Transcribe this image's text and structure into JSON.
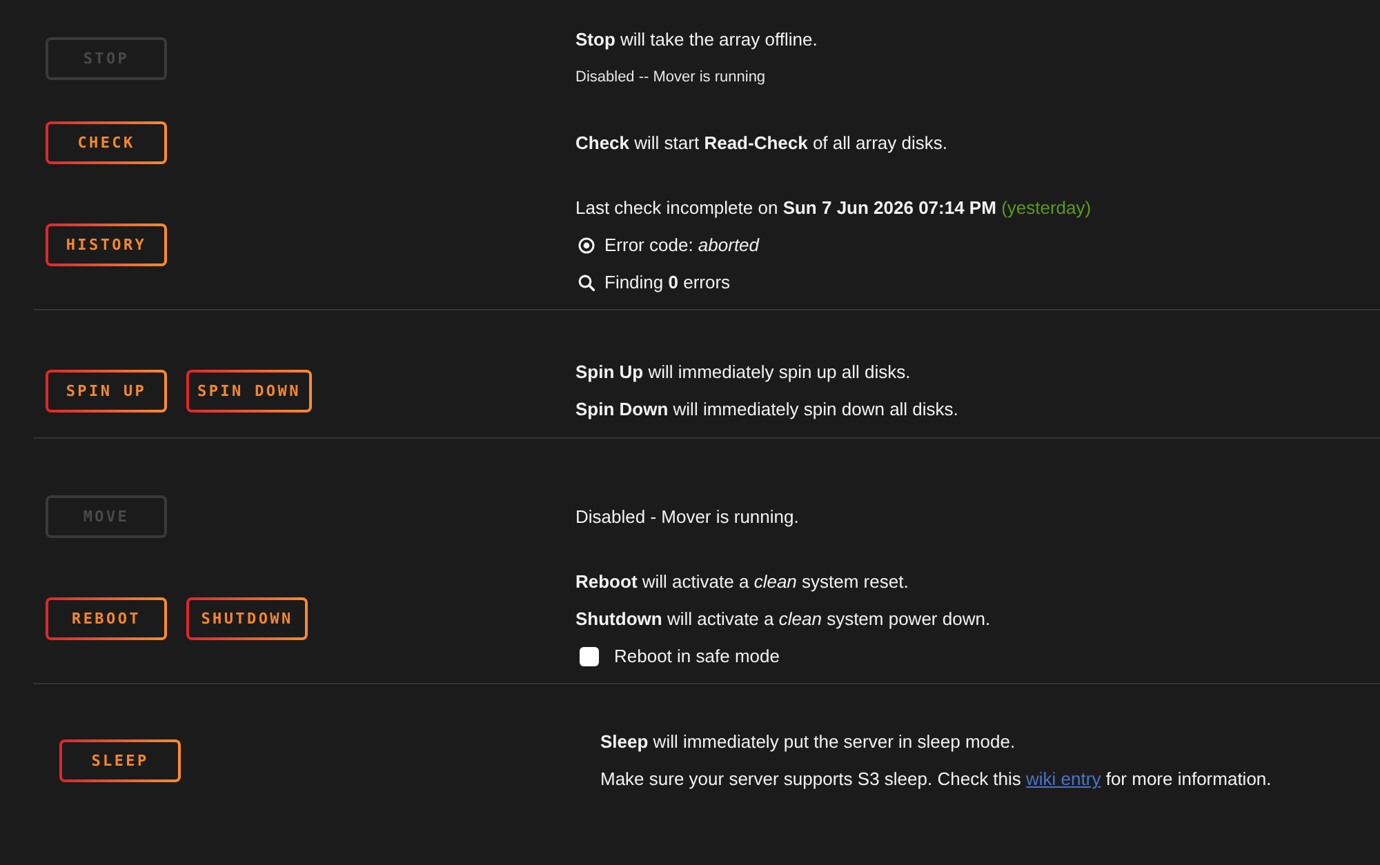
{
  "sections": [
    {
      "rows": [
        {
          "buttons": [
            {
              "label": "STOP",
              "disabled": true
            }
          ],
          "lines": [
            {
              "kind": "text",
              "text": "**Stop** will take the array offline."
            },
            {
              "kind": "note",
              "text": "Disabled -- Mover is running"
            }
          ]
        },
        {
          "buttons": [
            {
              "label": "CHECK",
              "disabled": false
            }
          ],
          "lines": [
            {
              "kind": "text",
              "text": "**Check** will start **Read-Check** of all array disks."
            }
          ]
        },
        {
          "buttons": [
            {
              "label": "HISTORY",
              "disabled": false
            }
          ],
          "lines": [
            {
              "kind": "dated",
              "text": "Last check incomplete on **Sun 7 Jun 2026 07:14 PM**",
              "relative": "(yesterday)"
            },
            {
              "kind": "error",
              "text": "Error code: *aborted*"
            },
            {
              "kind": "finding",
              "text": "Finding **0** errors"
            }
          ]
        }
      ]
    },
    {
      "rows": [
        {
          "buttons": [
            {
              "label": "SPIN UP",
              "disabled": false
            },
            {
              "label": "SPIN DOWN",
              "disabled": false
            }
          ],
          "lines": [
            {
              "kind": "text",
              "text": "**Spin Up** will immediately spin up all disks."
            },
            {
              "kind": "text",
              "text": "**Spin Down** will immediately spin down all disks."
            }
          ]
        }
      ]
    },
    {
      "rows": [
        {
          "buttons": [
            {
              "label": "MOVE",
              "disabled": true
            }
          ],
          "lines": [
            {
              "kind": "text",
              "text": "Disabled - Mover is running."
            }
          ]
        },
        {
          "buttons": [
            {
              "label": "REBOOT",
              "disabled": false
            },
            {
              "label": "SHUTDOWN",
              "disabled": false
            }
          ],
          "lines": [
            {
              "kind": "text",
              "text": "**Reboot** will activate a *clean* system reset."
            },
            {
              "kind": "text",
              "text": "**Shutdown** will activate a *clean* system power down."
            },
            {
              "kind": "checkbox",
              "label": "Reboot in safe mode",
              "checked": false
            }
          ]
        }
      ]
    },
    {
      "rows": [
        {
          "buttons": [
            {
              "label": "SLEEP",
              "disabled": false
            }
          ],
          "lines": [
            {
              "kind": "text",
              "text": "**Sleep** will immediately put the server in sleep mode."
            },
            {
              "kind": "link",
              "before": "Make sure your server supports S3 sleep. Check this",
              "link": "wiki entry",
              "after": "for more information."
            }
          ]
        }
      ]
    }
  ]
}
